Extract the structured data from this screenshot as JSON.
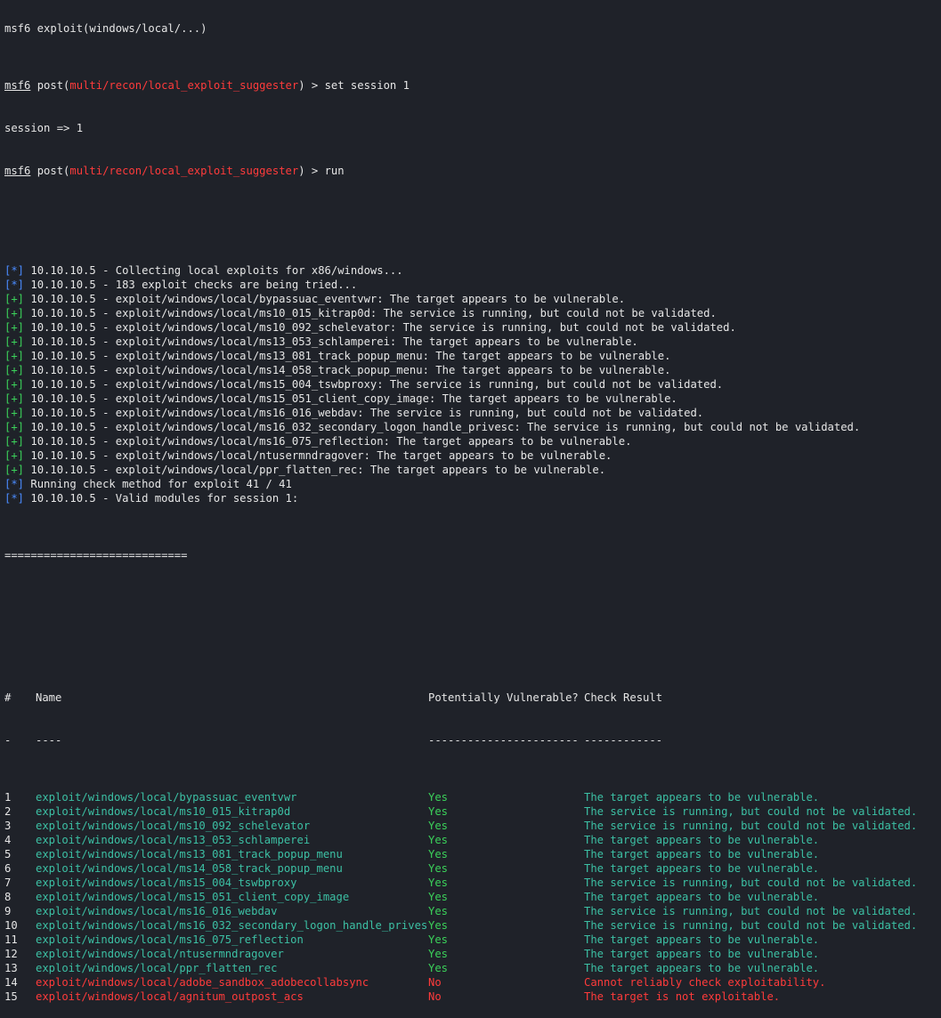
{
  "colors": {
    "background": "#1f2229",
    "text": "#e6e6e6",
    "module_path": "#ff3b3b",
    "info_marker": "#4a8cff",
    "good_marker": "#3bd15a",
    "table_name": "#3cc0a4",
    "yes": "#3bd15a",
    "no": "#ff3b3b"
  },
  "clipped_top_line": "msf6 exploit(windows/local/...)",
  "prompt": {
    "label": "msf6",
    "post_open": " post(",
    "module": "multi/recon/local_exploit_suggester",
    "post_close": ") > "
  },
  "commands": [
    {
      "cmd": "set session 1",
      "output": "session => 1"
    },
    {
      "cmd": "run",
      "output": ""
    }
  ],
  "markers": {
    "info": "[*]",
    "good": "[+]"
  },
  "log": [
    {
      "type": "info",
      "text": " 10.10.10.5 - Collecting local exploits for x86/windows..."
    },
    {
      "type": "info",
      "text": " 10.10.10.5 - 183 exploit checks are being tried..."
    },
    {
      "type": "good",
      "text": " 10.10.10.5 - exploit/windows/local/bypassuac_eventvwr: The target appears to be vulnerable."
    },
    {
      "type": "good",
      "text": " 10.10.10.5 - exploit/windows/local/ms10_015_kitrap0d: The service is running, but could not be validated."
    },
    {
      "type": "good",
      "text": " 10.10.10.5 - exploit/windows/local/ms10_092_schelevator: The service is running, but could not be validated."
    },
    {
      "type": "good",
      "text": " 10.10.10.5 - exploit/windows/local/ms13_053_schlamperei: The target appears to be vulnerable."
    },
    {
      "type": "good",
      "text": " 10.10.10.5 - exploit/windows/local/ms13_081_track_popup_menu: The target appears to be vulnerable."
    },
    {
      "type": "good",
      "text": " 10.10.10.5 - exploit/windows/local/ms14_058_track_popup_menu: The target appears to be vulnerable."
    },
    {
      "type": "good",
      "text": " 10.10.10.5 - exploit/windows/local/ms15_004_tswbproxy: The service is running, but could not be validated."
    },
    {
      "type": "good",
      "text": " 10.10.10.5 - exploit/windows/local/ms15_051_client_copy_image: The target appears to be vulnerable."
    },
    {
      "type": "good",
      "text": " 10.10.10.5 - exploit/windows/local/ms16_016_webdav: The service is running, but could not be validated."
    },
    {
      "type": "good",
      "text": " 10.10.10.5 - exploit/windows/local/ms16_032_secondary_logon_handle_privesc: The service is running, but could not be validated."
    },
    {
      "type": "good",
      "text": " 10.10.10.5 - exploit/windows/local/ms16_075_reflection: The target appears to be vulnerable."
    },
    {
      "type": "good",
      "text": " 10.10.10.5 - exploit/windows/local/ntusermndragover: The target appears to be vulnerable."
    },
    {
      "type": "good",
      "text": " 10.10.10.5 - exploit/windows/local/ppr_flatten_rec: The target appears to be vulnerable."
    },
    {
      "type": "info",
      "text": " Running check method for exploit 41 / 41"
    },
    {
      "type": "info",
      "text": " 10.10.10.5 - Valid modules for session 1:"
    }
  ],
  "separator": "============================",
  "table": {
    "headers": {
      "num": "#",
      "name": "Name",
      "vuln": "Potentially Vulnerable?",
      "result": "Check Result"
    },
    "underlines": {
      "num": "-",
      "name": "----",
      "vuln": "-----------------------",
      "result": "------------"
    },
    "rows": [
      {
        "num": "1",
        "name": "exploit/windows/local/bypassuac_eventvwr",
        "vuln": "Yes",
        "result": "The target appears to be vulnerable."
      },
      {
        "num": "2",
        "name": "exploit/windows/local/ms10_015_kitrap0d",
        "vuln": "Yes",
        "result": "The service is running, but could not be validated."
      },
      {
        "num": "3",
        "name": "exploit/windows/local/ms10_092_schelevator",
        "vuln": "Yes",
        "result": "The service is running, but could not be validated."
      },
      {
        "num": "4",
        "name": "exploit/windows/local/ms13_053_schlamperei",
        "vuln": "Yes",
        "result": "The target appears to be vulnerable."
      },
      {
        "num": "5",
        "name": "exploit/windows/local/ms13_081_track_popup_menu",
        "vuln": "Yes",
        "result": "The target appears to be vulnerable."
      },
      {
        "num": "6",
        "name": "exploit/windows/local/ms14_058_track_popup_menu",
        "vuln": "Yes",
        "result": "The target appears to be vulnerable."
      },
      {
        "num": "7",
        "name": "exploit/windows/local/ms15_004_tswbproxy",
        "vuln": "Yes",
        "result": "The service is running, but could not be validated."
      },
      {
        "num": "8",
        "name": "exploit/windows/local/ms15_051_client_copy_image",
        "vuln": "Yes",
        "result": "The target appears to be vulnerable."
      },
      {
        "num": "9",
        "name": "exploit/windows/local/ms16_016_webdav",
        "vuln": "Yes",
        "result": "The service is running, but could not be validated."
      },
      {
        "num": "10",
        "name": "exploit/windows/local/ms16_032_secondary_logon_handle_privesc",
        "vuln": "Yes",
        "result": "The service is running, but could not be validated."
      },
      {
        "num": "11",
        "name": "exploit/windows/local/ms16_075_reflection",
        "vuln": "Yes",
        "result": "The target appears to be vulnerable."
      },
      {
        "num": "12",
        "name": "exploit/windows/local/ntusermndragover",
        "vuln": "Yes",
        "result": "The target appears to be vulnerable."
      },
      {
        "num": "13",
        "name": "exploit/windows/local/ppr_flatten_rec",
        "vuln": "Yes",
        "result": "The target appears to be vulnerable."
      },
      {
        "num": "14",
        "name": "exploit/windows/local/adobe_sandbox_adobecollabsync",
        "vuln": "No",
        "result": "Cannot reliably check exploitability."
      },
      {
        "num": "15",
        "name": "exploit/windows/local/agnitum_outpost_acs",
        "vuln": "No",
        "result": "The target is not exploitable."
      }
    ]
  }
}
